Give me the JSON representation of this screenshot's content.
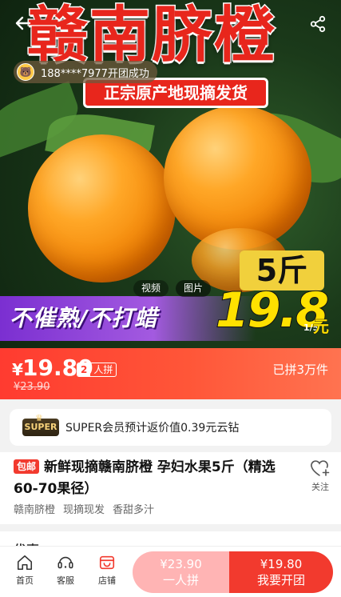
{
  "hero": {
    "title": "赣南脐橙",
    "subtitle": "正宗原产地现摘发货",
    "notification": "188****7977开团成功",
    "promo": "不催熟/不打蜡",
    "weight": "5斤",
    "big_price": "19.8",
    "big_price_unit": "元",
    "per_unit": "1/5",
    "media_tabs": [
      "视频",
      "图片"
    ],
    "active_tab": "图片"
  },
  "price": {
    "currency": "¥",
    "current": "19.80",
    "group_size": "2",
    "group_label": "人拼",
    "original": "¥23.90",
    "sold": "已拼3万件"
  },
  "super": {
    "badge": "SUPER",
    "text": "SUPER会员预计返价值0.39元云钻"
  },
  "product": {
    "free_shipping": "包邮",
    "title": "新鲜现摘赣南脐橙 孕妇水果5斤（精选60-70果径）",
    "follow": "关注",
    "tags": [
      "赣南脐橙",
      "现摘现发",
      "香甜多汁"
    ]
  },
  "next_section": {
    "label": "优惠"
  },
  "bottom": {
    "nav": [
      {
        "label": "首页",
        "icon": "home-icon"
      },
      {
        "label": "客服",
        "icon": "service-icon"
      },
      {
        "label": "店铺",
        "icon": "store-icon"
      }
    ],
    "single": {
      "price": "¥23.90",
      "label": "一人拼"
    },
    "group": {
      "price": "¥19.80",
      "label": "我要开团"
    }
  },
  "colors": {
    "accent": "#f23a2e",
    "promo_purple": "#8a3fd8",
    "price_yellow": "#ffe100"
  }
}
